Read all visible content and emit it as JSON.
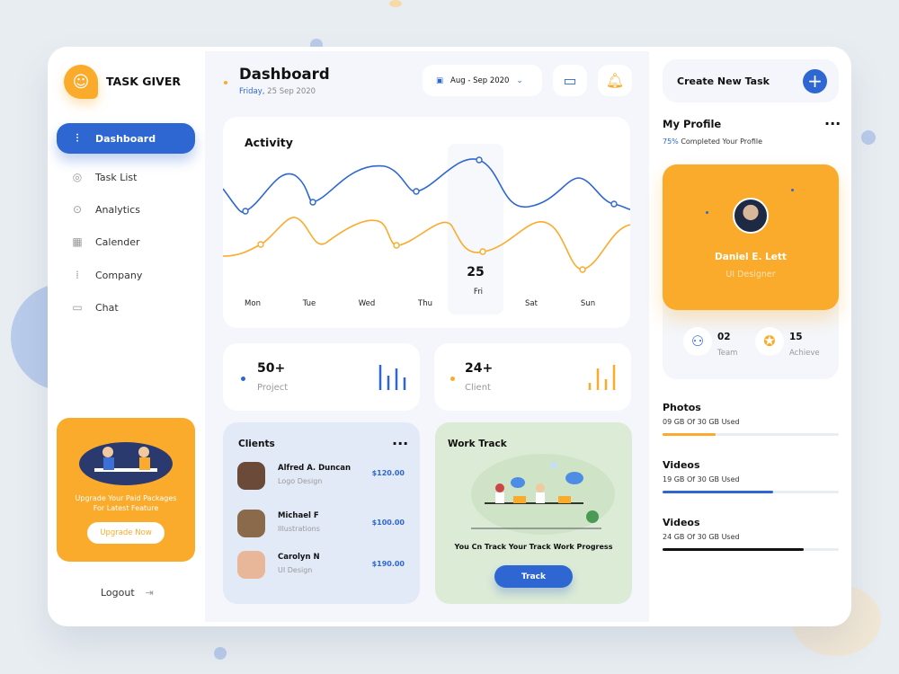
{
  "brand": {
    "name": "TASK GIVER"
  },
  "sidebar": {
    "items": [
      {
        "label": "Dashboard",
        "icon": "chart-icon"
      },
      {
        "label": "Task List",
        "icon": "user-icon"
      },
      {
        "label": "Analytics",
        "icon": "search-icon"
      },
      {
        "label": "Calender",
        "icon": "calendar-icon"
      },
      {
        "label": "Company",
        "icon": "company-icon"
      },
      {
        "label": "Chat",
        "icon": "chat-icon"
      }
    ],
    "promo": {
      "text": "Upgrade Your Paid Packages For Latest Feature",
      "button": "Upgrade Now"
    },
    "logout": "Logout"
  },
  "header": {
    "title": "Dashboard",
    "day": "Friday,",
    "date": "25 Sep 2020",
    "date_range": "Aug - Sep 2020"
  },
  "activity": {
    "title": "Activity",
    "days": [
      "Mon",
      "Tue",
      "Wed",
      "Thu",
      "Fri",
      "Sat",
      "Sun"
    ],
    "selected_day_number": "25",
    "colors": {
      "series1": "#2e67d1",
      "series2": "#fbab2b"
    }
  },
  "stats": [
    {
      "value": "50+",
      "label": "Project",
      "color": "#2e67d1"
    },
    {
      "value": "24+",
      "label": "Client",
      "color": "#fbab2b"
    }
  ],
  "clients": {
    "title": "Clients",
    "items": [
      {
        "name": "Alfred A. Duncan",
        "role": "Logo Design",
        "amount": "$120.00"
      },
      {
        "name": "Michael F",
        "role": "Illustrations",
        "amount": "$100.00"
      },
      {
        "name": "Carolyn N",
        "role": "UI Design",
        "amount": "$190.00"
      }
    ]
  },
  "work_track": {
    "title": "Work Track",
    "text": "You Cn Track Your Track Work Progress",
    "button": "Track"
  },
  "right": {
    "create_task": "Create New Task",
    "profile": {
      "title": "My Profile",
      "percent": "75%",
      "completed": "Completed Your Profile",
      "name": "Daniel E. Lett",
      "role": "UI Designer",
      "team_count": "02",
      "team_label": "Team",
      "achieve_count": "15",
      "achieve_label": "Achieve"
    },
    "storage": [
      {
        "title": "Photos",
        "used": "09 GB Of 30 GB Used",
        "fraction": 0.3,
        "color": "#fbab2b"
      },
      {
        "title": "Videos",
        "used": "19 GB Of 30 GB Used",
        "fraction": 0.63,
        "color": "#2e67d1"
      },
      {
        "title": "Videos",
        "used": "24 GB Of 30 GB Used",
        "fraction": 0.8,
        "color": "#111111"
      }
    ]
  }
}
